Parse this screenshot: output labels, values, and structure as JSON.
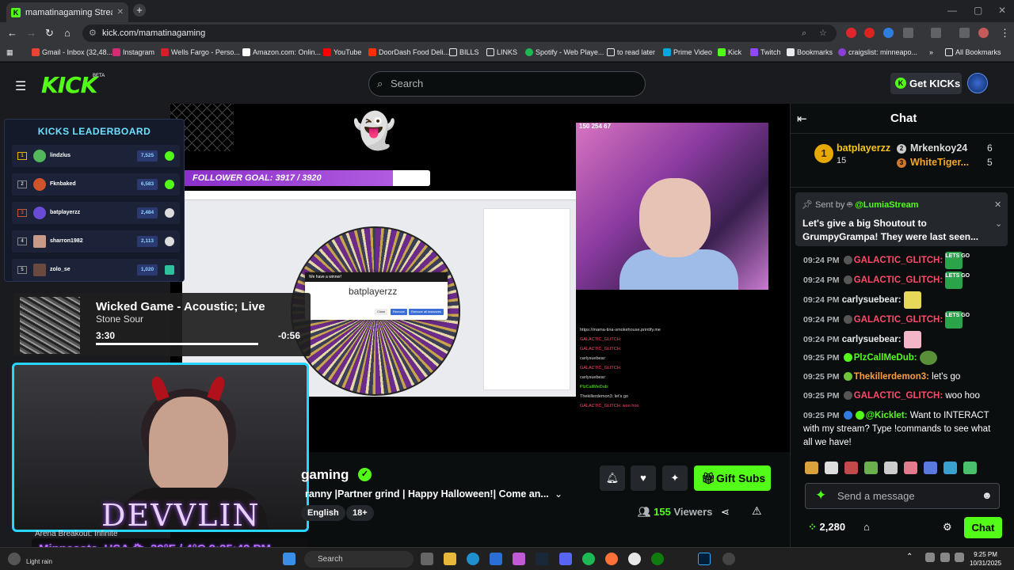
{
  "browser": {
    "tab_title": "mamatinagaming Stream - Wa",
    "tab_close": "✕",
    "new_tab": "+",
    "url": "kick.com/mamatinagaming",
    "bookmarks": [
      "Gmail - Inbox (32,48...",
      "Instagram",
      "Wells Fargo - Perso...",
      "Amazon.com: Onlin...",
      "YouTube",
      "DoorDash Food Deli...",
      "BILLS",
      "LINKS",
      "Spotify - Web Playe...",
      "to read later",
      "Prime Video",
      "Kick",
      "Twitch",
      "Bookmarks",
      "craigslist: minneapo...",
      "All Bookmarks"
    ]
  },
  "kick": {
    "logo": "KICK",
    "beta": "BETA",
    "search_placeholder": "Search",
    "get_kicks": "Get KICKs"
  },
  "video": {
    "follower_goal": "FOLLOWER GOAL: 3917 / 3920",
    "winner_header": "We have a winner!",
    "winner_name": "batplayerzz",
    "winner_buttons": [
      "Close",
      "Remove",
      "Remove all instances"
    ],
    "cam_stats": "150  254  67",
    "onstream_url": "https://mama-tina-smokehouse.printify.me",
    "onstream_lines": [
      {
        "user": "GALACTIC_GLITCH:",
        "cls": "g"
      },
      {
        "user": "GALACTIC_GLITCH:",
        "cls": "g"
      },
      {
        "user": "carlysuebear:",
        "cls": ""
      },
      {
        "user": "GALACTIC_GLITCH:",
        "cls": "g"
      },
      {
        "user": "carlysuebear:",
        "cls": ""
      },
      {
        "user": "PlzCallMeDub:",
        "cls": "p"
      },
      {
        "user": "Thekillerdemon3: let's go",
        "cls": ""
      },
      {
        "user": "GALACTIC_GLITCH: woo hoo",
        "cls": "g"
      }
    ]
  },
  "leaderboard": {
    "title": "KICKS LEADERBOARD",
    "rows": [
      {
        "rank": "1",
        "name": "lindzlus",
        "score": "7,525"
      },
      {
        "rank": "2",
        "name": "Fknbaked",
        "score": "6,583"
      },
      {
        "rank": "3",
        "name": "batplayerzz",
        "score": "2,484"
      },
      {
        "rank": "4",
        "name": "sharron1982",
        "score": "2,113"
      },
      {
        "rank": "5",
        "name": "zolo_se",
        "score": "1,020"
      }
    ]
  },
  "music": {
    "song": "Wicked Game - Acoustic; Live",
    "artist": "Stone Sour",
    "elapsed": "3:30",
    "remaining": "-0:56",
    "progress": 0.79
  },
  "overlay": {
    "devvlin": "DEVVLIN",
    "arena": "Arena Breakout: Infinite",
    "weather": "Minnesota, USA 🌥 39°F / 4°C  9:25:42 PM"
  },
  "stream": {
    "name": "gaming",
    "title": "ranny |Partner grind  | Happy Halloween!| Come an...",
    "tags": [
      "English",
      "18+"
    ],
    "viewers_count": "155",
    "viewers_label": "Viewers",
    "gift_subs": "Gift Subs"
  },
  "chat": {
    "title": "Chat",
    "top_gifter": {
      "name": "batplayerzz",
      "count": "15"
    },
    "second": {
      "name": "Mrkenkoy24",
      "count": "6"
    },
    "third": {
      "name": "WhiteTiger...",
      "count": "5"
    },
    "pinned_by": "Sent by",
    "pinned_user": "@LumiaStream",
    "pinned_msg": "Let's give a big Shoutout to GrumpyGrampa! They were last seen...",
    "messages": [
      {
        "time": "09:24 PM",
        "user": "GALACTIC_GLITCH:",
        "color": "#ff4a6a",
        "text": "",
        "emote": "lets-go"
      },
      {
        "time": "09:24 PM",
        "user": "GALACTIC_GLITCH:",
        "color": "#ff4a6a",
        "text": "",
        "emote": "lets-go"
      },
      {
        "time": "09:24 PM",
        "user": "carlysuebear:",
        "color": "#e8eaed",
        "text": "",
        "emote": "yellow"
      },
      {
        "time": "09:24 PM",
        "user": "GALACTIC_GLITCH:",
        "color": "#ff4a6a",
        "text": "",
        "emote": "lets-go"
      },
      {
        "time": "09:24 PM",
        "user": "carlysuebear:",
        "color": "#e8eaed",
        "text": "",
        "emote": "pink"
      },
      {
        "time": "09:25 PM",
        "user": "PlzCallMeDub:",
        "color": "#53fc18",
        "text": "",
        "emote": "frog"
      },
      {
        "time": "09:25 PM",
        "user": "Thekillerdemon3:",
        "color": "#ff9d3a",
        "text": "let's go",
        "emote": ""
      },
      {
        "time": "09:25 PM",
        "user": "GALACTIC_GLITCH:",
        "color": "#ff4a6a",
        "text": "woo hoo",
        "emote": ""
      },
      {
        "time": "09:25 PM",
        "user": "@Kicklet:",
        "color": "#53fc18",
        "text": "Want to INTERACT",
        "emote": ""
      }
    ],
    "kicklet_cont1": "with my stream? Type !commands to see what",
    "kicklet_cont2": "all we have!",
    "emote_text": "LETS GO",
    "send_placeholder": "Send a message",
    "points": "2,280",
    "chat_button": "Chat"
  },
  "taskbar": {
    "weather": "Light rain",
    "search": "Search",
    "time": "9:25 PM",
    "date": "10/31/2025"
  }
}
